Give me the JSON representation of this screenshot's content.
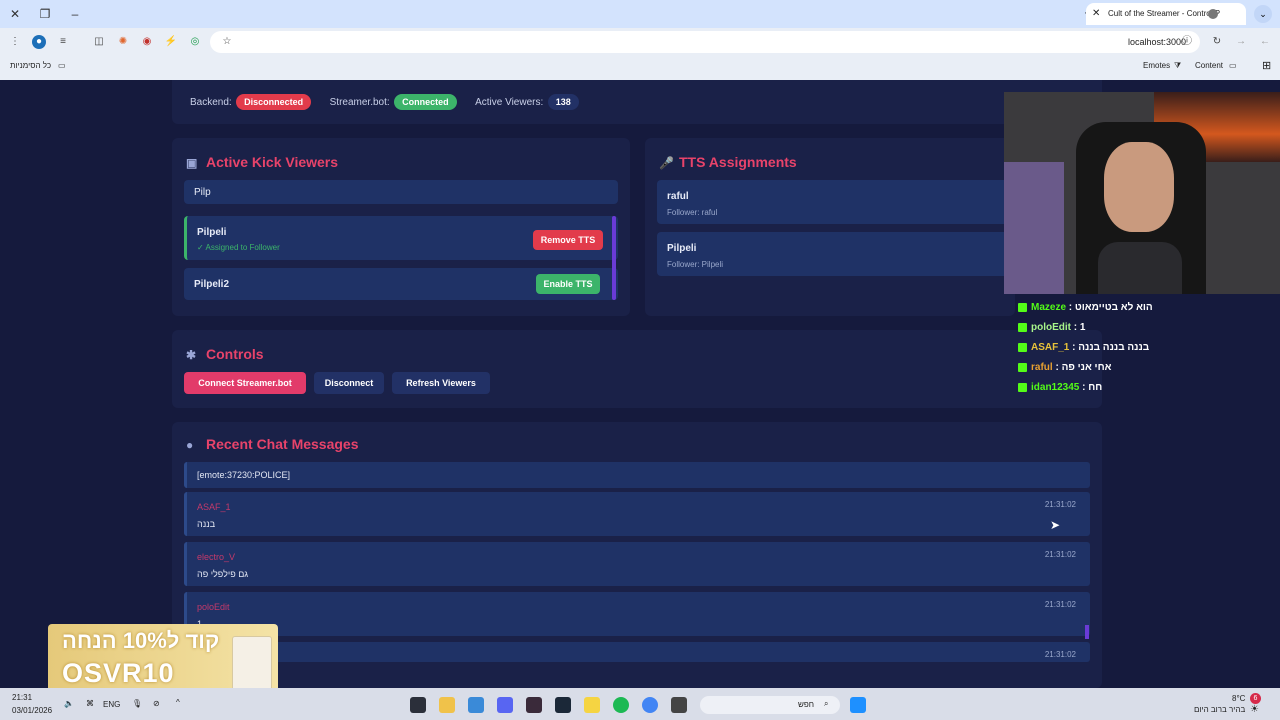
{
  "browser": {
    "tab_title": "Cult of the Streamer - Control P",
    "url": "localhost:3000",
    "bookmarks_all": "כל הסימניות",
    "bookmarks": [
      "Emotes",
      "Content"
    ]
  },
  "status": {
    "backend_label": "Backend:",
    "backend_value": "Disconnected",
    "streamerbot_label": "Streamer.bot:",
    "streamerbot_value": "Connected",
    "viewers_label": "Active Viewers:",
    "viewers_value": "138"
  },
  "kick": {
    "title": "Active Kick Viewers",
    "search_value": "Pilp",
    "viewers": [
      {
        "name": "Pilpeli",
        "status": "✓ Assigned to Follower",
        "action": "Remove TTS"
      },
      {
        "name": "Pilpeli2",
        "status": "",
        "action": "Enable TTS"
      }
    ]
  },
  "tts": {
    "title": "TTS Assignments",
    "items": [
      {
        "name": "raful",
        "sub": "Follower: raful"
      },
      {
        "name": "Pilpeli",
        "sub": "Follower: Pilpeli"
      }
    ]
  },
  "controls": {
    "title": "Controls",
    "connect": "Connect Streamer.bot",
    "disconnect": "Disconnect",
    "refresh": "Refresh Viewers"
  },
  "chat": {
    "title": "Recent Chat Messages",
    "partial_top": "[emote:37230:POLICE]",
    "messages": [
      {
        "user": "ASAF_1",
        "text": "בננה",
        "time": "21:31:02"
      },
      {
        "user": "electro_V",
        "text": "גם פילפלי פה",
        "time": "21:31:02"
      },
      {
        "user": "poloEdit",
        "text": "1",
        "time": "21:31:02"
      }
    ],
    "partial_time": "21:31:02"
  },
  "overlay_chat": [
    {
      "user": "Mazeze",
      "text": "הוא לא בטיימאוט",
      "color": "#53fc18"
    },
    {
      "user": "poloEdit",
      "text": "1",
      "color": "#53fc18"
    },
    {
      "user": "ASAF_1",
      "text": "בננה בננה בננה",
      "color": "#e8c23a"
    },
    {
      "user": "raful",
      "text": "אחי אני פה",
      "color": "#e8a030"
    },
    {
      "user": "idan12345",
      "text": "חח",
      "color": "#53fc18"
    }
  ],
  "promo": {
    "line1": "קוד ל10% הנחה",
    "line2": "OSVR10"
  },
  "taskbar": {
    "time": "21:31",
    "date": "03/01/2026",
    "lang": "ENG",
    "search": "חפש",
    "weather_temp": "8°C",
    "weather_text": "בהיר ברוב היום",
    "notif_count": "6"
  },
  "colors": {
    "accent": "#e8436a",
    "bg": "#151a3d",
    "card": "#1a2148",
    "row": "#1f3266"
  }
}
